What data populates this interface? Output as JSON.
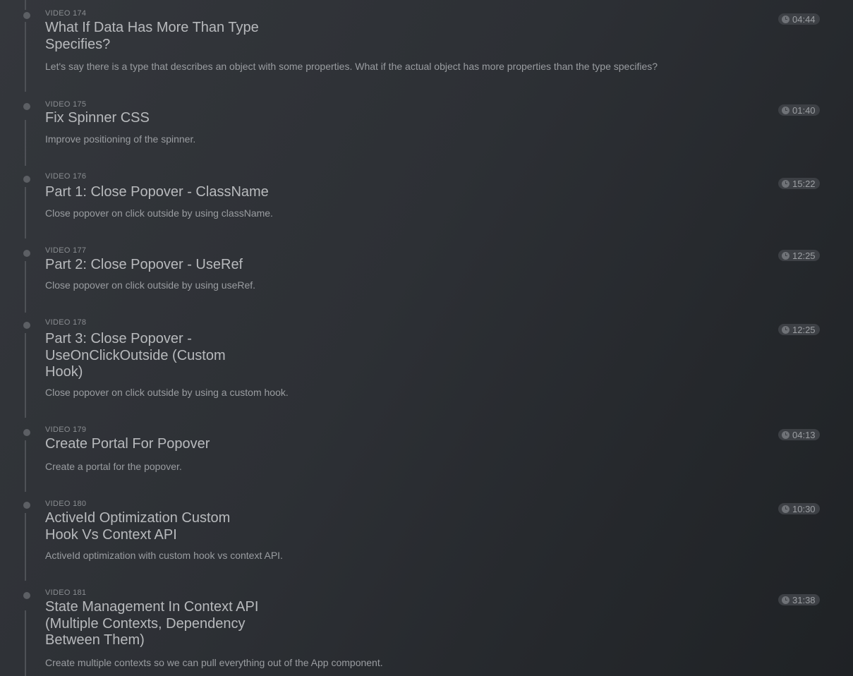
{
  "videos": [
    {
      "number_label": "VIDEO 174",
      "title": "What If Data Has More Than Type Specifies?",
      "description": "Let's say there is a type that describes an object with some properties. What if the actual object has more properties than the type specifies?",
      "duration": "04:44"
    },
    {
      "number_label": "VIDEO 175",
      "title": "Fix Spinner CSS",
      "description": "Improve positioning of the spinner.",
      "duration": "01:40"
    },
    {
      "number_label": "VIDEO 176",
      "title": "Part 1: Close Popover - ClassName",
      "description": "Close popover on click outside by using className.",
      "duration": "15:22"
    },
    {
      "number_label": "VIDEO 177",
      "title": "Part 2: Close Popover - UseRef",
      "description": "Close popover on click outside by using useRef.",
      "duration": "12:25"
    },
    {
      "number_label": "VIDEO 178",
      "title": "Part 3: Close Popover - UseOnClickOutside (Custom Hook)",
      "description": "Close popover on click outside by using a custom hook.",
      "duration": "12:25"
    },
    {
      "number_label": "VIDEO 179",
      "title": "Create Portal For Popover",
      "description": "Create a portal for the popover.",
      "duration": "04:13"
    },
    {
      "number_label": "VIDEO 180",
      "title": "ActiveId Optimization Custom Hook Vs Context API",
      "description": "ActiveId optimization with custom hook vs context API.",
      "duration": "10:30"
    },
    {
      "number_label": "VIDEO 181",
      "title": "State Management In Context API (Multiple Contexts, Dependency Between Them)",
      "description": "Create multiple contexts so we can pull everything out of the App component.",
      "duration": "31:38"
    }
  ]
}
